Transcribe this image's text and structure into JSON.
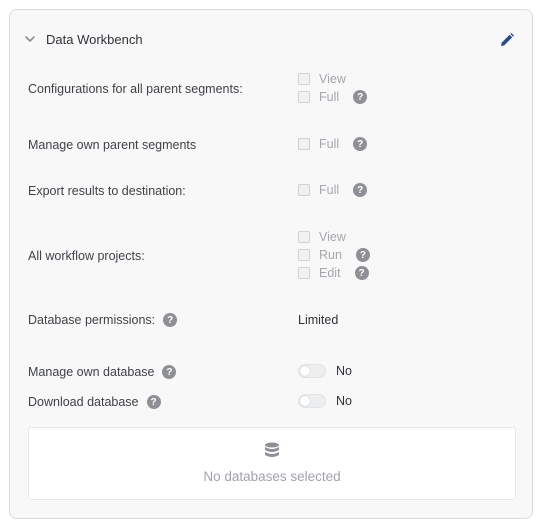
{
  "section": {
    "title": "Data Workbench",
    "chevron_icon": "chevron-down-icon",
    "edit_icon": "pencil-icon",
    "accent_color": "#2d4a8a"
  },
  "permissions": {
    "configurations": {
      "label": "Configurations for all parent segments:",
      "options": [
        {
          "label": "View",
          "checked": false
        },
        {
          "label": "Full",
          "checked": false,
          "help": "?"
        }
      ]
    },
    "manage_parent_segments": {
      "label": "Manage own parent segments",
      "options": [
        {
          "label": "Full",
          "checked": false,
          "help": "?"
        }
      ]
    },
    "export_results": {
      "label": "Export results to destination:",
      "options": [
        {
          "label": "Full",
          "checked": false,
          "help": "?"
        }
      ]
    },
    "workflow_projects": {
      "label": "All workflow projects:",
      "options": [
        {
          "label": "View",
          "checked": false
        },
        {
          "label": "Run",
          "checked": false,
          "help": "?"
        },
        {
          "label": "Edit",
          "checked": false,
          "help": "?"
        }
      ]
    },
    "database_permissions": {
      "label": "Database permissions:",
      "help": "?",
      "value": "Limited"
    },
    "manage_own_database": {
      "label": "Manage own database",
      "help": "?",
      "toggle": false,
      "toggle_label": "No"
    },
    "download_database": {
      "label": "Download database",
      "help": "?",
      "toggle": false,
      "toggle_label": "No"
    }
  },
  "databases_empty": {
    "icon": "database-icon",
    "text": "No databases selected"
  }
}
